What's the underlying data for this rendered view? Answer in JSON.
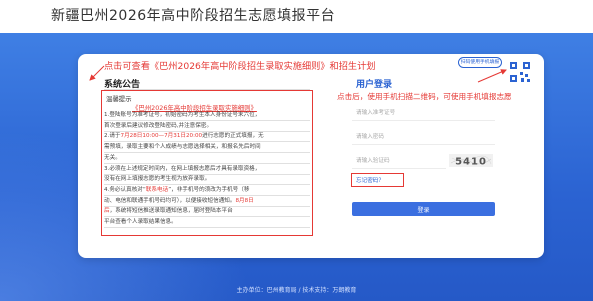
{
  "site": {
    "title": "新疆巴州2026年高中阶段招生志愿填报平台"
  },
  "annotations": {
    "top": "点击可查看《巴州2026年高中阶段招生录取实施细则》和招生计划",
    "right": "点击后，使用手机扫描二维码，可使用手机填报志愿"
  },
  "notice": {
    "title": "系统公告",
    "heading": "温馨提示",
    "link": "《巴州2026年高中阶段招生录取实施细则》",
    "lines": [
      {
        "parts": [
          {
            "text": "1.登陆账号为准考证号，初始密码为考生本人身份证号末六位，",
            "red": false
          }
        ]
      },
      {
        "parts": [
          {
            "text": "首次登录后建议修改登陆密码,并注意保密。",
            "red": false
          }
        ]
      },
      {
        "parts": [
          {
            "text": "2.请于",
            "red": false
          },
          {
            "text": "7月28日10:00—7月31日20:00",
            "red": true
          },
          {
            "text": "进行志愿的正式填报，无",
            "red": false
          }
        ]
      },
      {
        "parts": [
          {
            "text": "需预填，录取主要和个人成绩与志愿选择相关，和报名先后时间",
            "red": false
          }
        ]
      },
      {
        "parts": [
          {
            "text": "无关。",
            "red": false
          }
        ]
      },
      {
        "parts": [
          {
            "text": "3.必须在上述规定时间内，在网上填报志愿后才具有录取资格，",
            "red": false
          }
        ]
      },
      {
        "parts": [
          {
            "text": "没有在网上填报志愿的考生视为放弃录取。",
            "red": false
          }
        ]
      },
      {
        "parts": [
          {
            "text": "4.务必认真核对“",
            "red": false
          },
          {
            "text": "联系电话",
            "red": true
          },
          {
            "text": "”，非手机号的须改为手机号（移",
            "red": false
          }
        ]
      },
      {
        "parts": [
          {
            "text": "动、电信和联通手机号码均可），以便接收短信通知。",
            "red": false
          },
          {
            "text": "8月8日",
            "red": true
          }
        ]
      },
      {
        "parts": [
          {
            "text": "后",
            "red": true
          },
          {
            "text": "，系统将短信推送录取通知信息，届时登陆本",
            "red": false
          },
          {
            "text": "平台",
            "red": false
          }
        ]
      },
      {
        "parts": [
          {
            "text": "平台查看个人录取结果信息。",
            "red": false
          }
        ]
      }
    ]
  },
  "login": {
    "title": "用户登录",
    "qr_button": "扫码使用手机填报",
    "fields": {
      "exam_placeholder": "请输入准考证号",
      "password_placeholder": "请输入密码",
      "captcha_placeholder": "请输入验证码"
    },
    "captcha_text": "5410",
    "forgot": "忘记密码？",
    "submit": "登录"
  },
  "footer": {
    "text": "主办单位：巴州教育局 / 技术支持：万朗教育"
  },
  "colors": {
    "brand_blue": "#2b63d2",
    "annotation_red": "#e53935"
  },
  "icons": {
    "qr": "qr-code-icon",
    "arrow": "arrow-icon"
  }
}
